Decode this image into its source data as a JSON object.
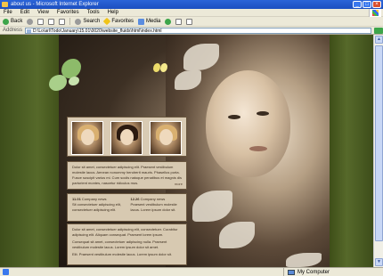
{
  "window": {
    "title": "about us - Microsoft Internet Explorer",
    "controls": [
      "_",
      "□",
      "×"
    ]
  },
  "menu": [
    "File",
    "Edit",
    "View",
    "Favorites",
    "Tools",
    "Help"
  ],
  "toolbar": {
    "back_label": "Back",
    "search_label": "Search",
    "favorites_label": "Favorites",
    "media_label": "Media"
  },
  "address": {
    "label": "Address",
    "url": "D:\\Lo\\arl\\Todo\\January\\15.01\\0020\\website_fluids\\html\\index.html"
  },
  "thumbnails": [
    {
      "style": "blonde",
      "icon": "portrait-blonde"
    },
    {
      "style": "dark",
      "icon": "portrait-dark"
    },
    {
      "style": "blonde",
      "icon": "portrait-light"
    }
  ],
  "intro": {
    "text": "Dolor sit amet, consectetuer adipiscing elit. Praesent vestibulum molestie lacus. Aenean nonummy hendrerit mauris. Phasellus porta. Fusce suscipit varius mi. Cum sociis natoque penatibus et magnis dis parturient montes, nascetur ridiculus mus.",
    "more": "more"
  },
  "news": [
    {
      "date": "11.01",
      "title": "Company news",
      "text": "Sit consectetuer adipiscing elit, consectetuer adipiscing elit."
    },
    {
      "date": "12.26",
      "title": "Company news",
      "text": "Praesent vestibulum molestie lacus. Lorem ipsum dolor sit."
    }
  ],
  "about": {
    "p1": "Dolor sit amet, consectetuer adipiscing elit, consectetuer. Curabitur adipiscing elit. Aliquam consequat. Praesent lorem ipsum.",
    "p2": "Consequat sit amet, consectetuer adipiscing nulla. Praesent vestibulum molestie lacus. Lorem ipsum dolor sit amet.",
    "p3": "Elit. Praesent vestibulum molestie lacus. Lorem ipsum dolor sit."
  },
  "status": {
    "left": "",
    "zone": "My Computer"
  },
  "colors": {
    "page_edge": "#4a5b22",
    "panel": "#d7c9b1",
    "titlebar": "#2b64d8"
  }
}
